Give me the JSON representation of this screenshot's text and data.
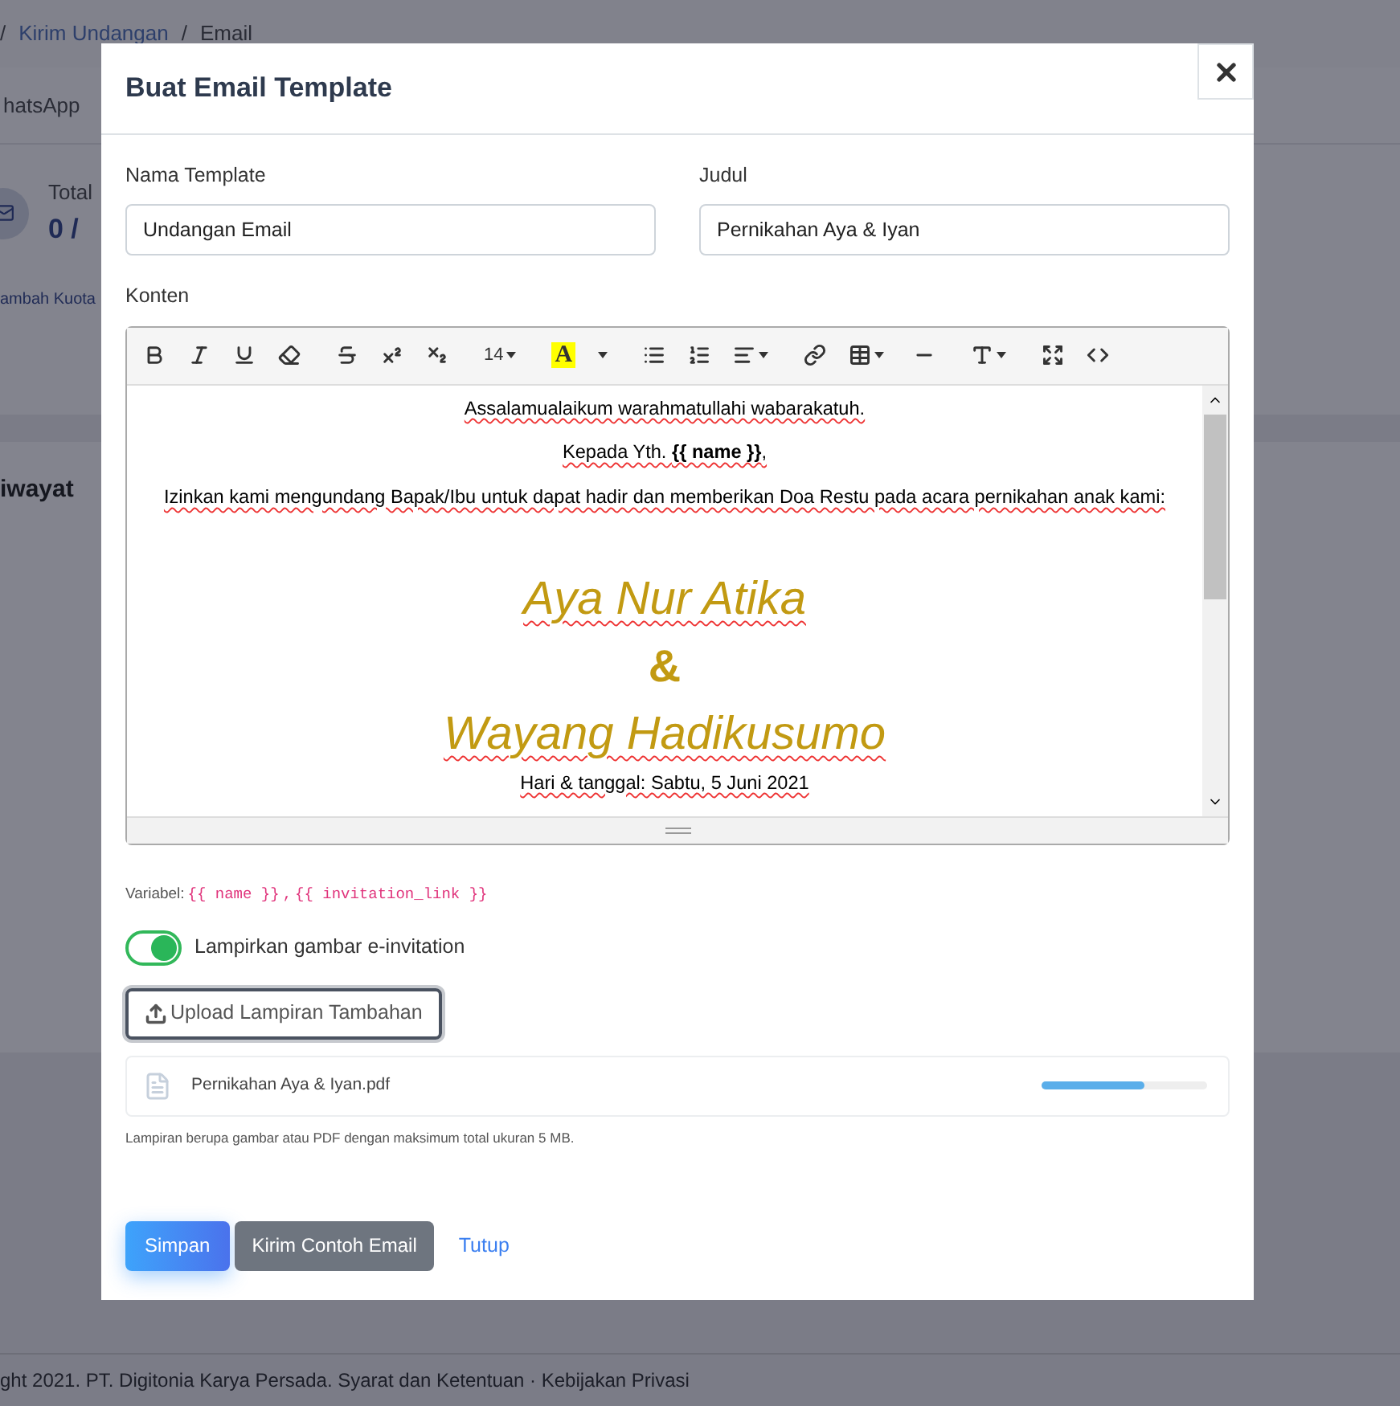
{
  "background_page": {
    "breadcrumb": [
      "/",
      "Kirim Undangan",
      "/",
      "Email"
    ],
    "tab_partial": "hatsApp",
    "stat_label": "Total",
    "stat_value": "0 /",
    "quota_link": "ambah Kuota",
    "section_title": "iwayat",
    "footer": "ght 2021. PT. Digitonia Karya Persada. Syarat dan Ketentuan · Kebijakan Privasi"
  },
  "modal": {
    "title": "Buat Email Template",
    "fields": [
      {
        "label": "Nama Template",
        "value": "Undangan Email"
      },
      {
        "label": "Judul",
        "value": "Pernikahan Aya & Iyan"
      }
    ],
    "editor": {
      "label": "Konten",
      "font_size": "14",
      "font_color_letter": "A",
      "toolbar": [
        {
          "kind": "bold"
        },
        {
          "kind": "italic"
        },
        {
          "kind": "underline"
        },
        {
          "kind": "eraser"
        },
        {
          "kind": "strikethrough"
        },
        {
          "kind": "superscript"
        },
        {
          "kind": "subscript"
        },
        {
          "kind": "fontsize"
        },
        {
          "kind": "color"
        },
        {
          "kind": "ul"
        },
        {
          "kind": "ol"
        },
        {
          "kind": "align"
        },
        {
          "kind": "link"
        },
        {
          "kind": "table"
        },
        {
          "kind": "hr"
        },
        {
          "kind": "height"
        },
        {
          "kind": "fullscreen"
        },
        {
          "kind": "code"
        }
      ],
      "content": [
        {
          "kind": "para",
          "text": "Assalamualaikum warahmatullahi wabarakatuh."
        },
        {
          "kind": "para",
          "text": "Kepada Yth. **{{ name }}**,"
        },
        {
          "kind": "para",
          "text": "Izinkan kami mengundang Bapak/Ibu untuk dapat hadir dan memberikan Doa Restu pada acara pernikahan anak kami:"
        },
        {
          "kind": "spacer"
        },
        {
          "kind": "name",
          "text": "Aya Nur Atika"
        },
        {
          "kind": "amp",
          "text": "&"
        },
        {
          "kind": "name",
          "text": "Wayang Hadikusumo"
        },
        {
          "kind": "para",
          "text": "Hari & tanggal: Sabtu, 5 Juni 2021"
        }
      ]
    },
    "variables_label": "Variabel:",
    "variables": [
      "{{ name }}",
      "{{ invitation_link }}"
    ],
    "variables_separator": ",",
    "attach_toggle": {
      "label": "Lampirkan gambar e-invitation",
      "on": true
    },
    "upload_button": "Upload Lampiran Tambahan",
    "attachments": [
      {
        "name": "Pernikahan Aya & Iyan.pdf",
        "level": 0.62
      }
    ],
    "hint": "Lampiran berupa gambar atau PDF dengan maksimum total ukuran 5 MB.",
    "buttons": [
      {
        "kind": "primary",
        "label": "Simpan"
      },
      {
        "kind": "secondary",
        "label": "Kirim Contoh Email"
      },
      {
        "kind": "link",
        "label": "Tutup"
      }
    ]
  }
}
